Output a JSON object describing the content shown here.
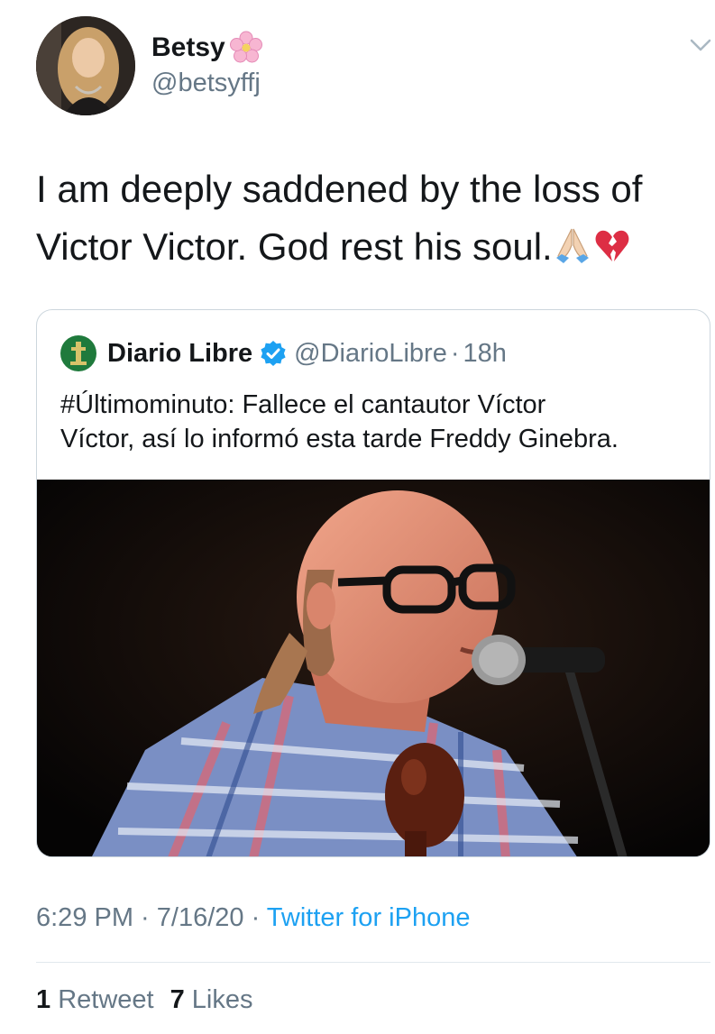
{
  "user": {
    "display_name": "Betsy",
    "name_emoji": "cherry-blossom",
    "handle": "@betsyffj"
  },
  "tweet": {
    "line1": "I am deeply saddened by the loss of",
    "line2": "Victor Victor. God rest his  soul.",
    "emojis": [
      "folded-hands",
      "broken-heart"
    ]
  },
  "quote": {
    "name": "Diario Libre",
    "handle": "@DiarioLibre",
    "separator": "·",
    "age": "18h",
    "text_line1": "#Últimominuto: Fallece el cantautor Víctor",
    "text_line2": "Víctor, así lo informó esta tarde Freddy Ginebra."
  },
  "meta": {
    "time": "6:29 PM",
    "sep1": " · ",
    "date": "7/16/20",
    "sep2": " · ",
    "source": "Twitter for iPhone"
  },
  "stats": {
    "retweets_count": "1",
    "retweets_label": "Retweet",
    "likes_count": "7",
    "likes_label": "Likes"
  },
  "colors": {
    "text": "#14171a",
    "secondary": "#657786",
    "link": "#1da1f2",
    "border": "#ccd6dd"
  }
}
